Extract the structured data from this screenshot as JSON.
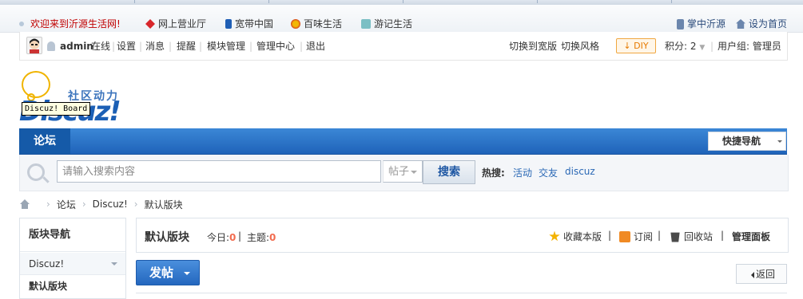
{
  "links_bar": {
    "welcome": "欢迎来到沂源生活网!",
    "items": [
      "网上营业厅",
      "宽带中国",
      "百味生活",
      "游记生活"
    ],
    "right": [
      "掌中沂源",
      "设为首页"
    ]
  },
  "user_bar": {
    "username": "admin",
    "status": "在线",
    "menu": [
      "设置",
      "消息",
      "提醒",
      "模块管理",
      "管理中心",
      "退出"
    ],
    "switch_width": "切换到宽版",
    "switch_style": "切换风格",
    "diy": "DIY",
    "points": "积分: 2",
    "user_group": "用户组: 管理员"
  },
  "logo": {
    "slogan": "社区动力",
    "wordmark": "Discuz!",
    "tooltip": "Discuz! Board"
  },
  "nav": {
    "forum": "论坛",
    "quick_nav": "快捷导航"
  },
  "search": {
    "placeholder": "请输入搜索内容",
    "type": "帖子",
    "button": "搜索",
    "hot_label": "热搜:",
    "hot_items": [
      "活动",
      "交友",
      "discuz"
    ]
  },
  "breadcrumb": [
    "论坛",
    "Discuz!",
    "默认版块"
  ],
  "sidebar": {
    "title": "版块导航",
    "group": "Discuz!",
    "current": "默认版块"
  },
  "forum_header": {
    "title": "默认版块",
    "today_label": "今日:",
    "today_value": "0",
    "topics_label": "主题:",
    "topics_value": "0",
    "actions": [
      "收藏本版",
      "订阅",
      "回收站",
      "管理面板"
    ]
  },
  "post_button": "发帖",
  "back_button": "返回",
  "colors": {
    "accent": "#2467bf",
    "welcome_red": "#c00000",
    "number_orange": "#f26c4f"
  }
}
